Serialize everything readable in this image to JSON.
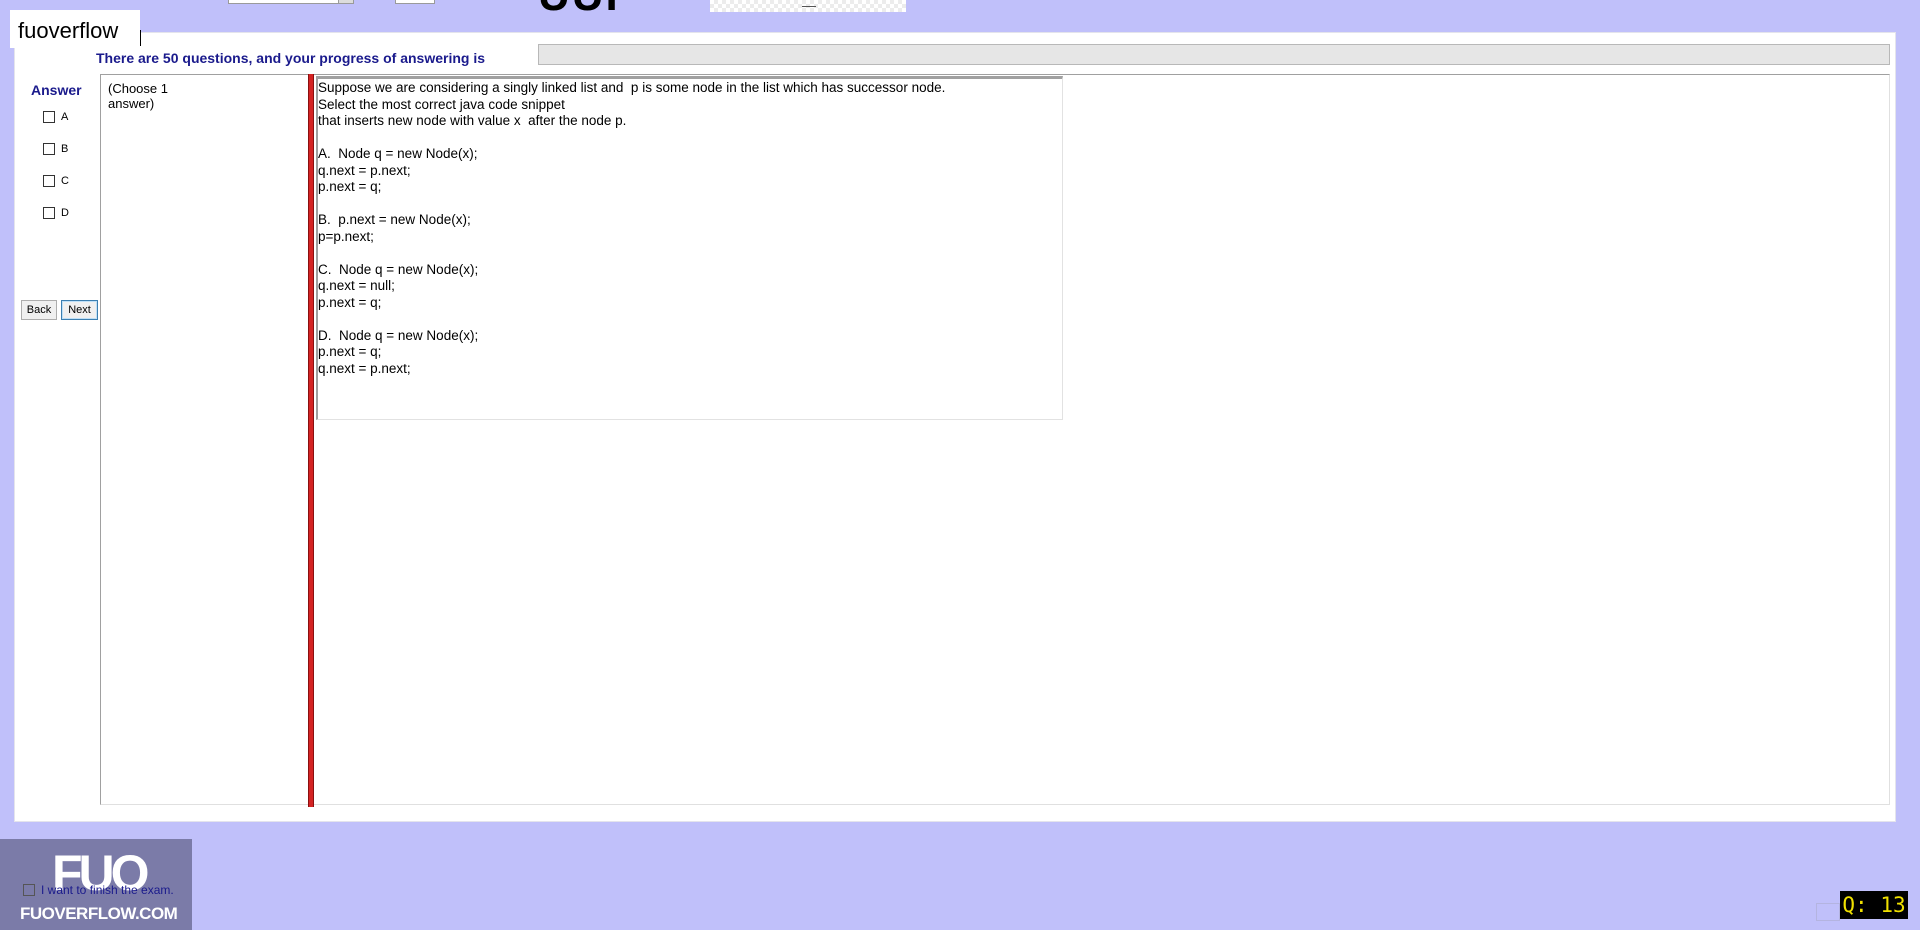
{
  "app": {
    "brand": "fuoverflow",
    "title_partial": "UUF"
  },
  "progress": {
    "label": "There are 50 questions, and your progress of answering is",
    "value_percent": 0,
    "fill_color": "#06b025"
  },
  "answer_panel": {
    "title": "Answer",
    "options": [
      {
        "label": "A",
        "checked": false
      },
      {
        "label": "B",
        "checked": false
      },
      {
        "label": "C",
        "checked": false
      },
      {
        "label": "D",
        "checked": false
      }
    ],
    "back_label": "Back",
    "next_label": "Next"
  },
  "choose": {
    "text": "(Choose 1 answer)"
  },
  "question": {
    "text": "Suppose we are considering a singly linked list and  p is some node in the list which has successor node.\nSelect the most correct java code snippet\nthat inserts new node with value x  after the node p.\n\nA.  Node q = new Node(x);\nq.next = p.next;\np.next = q;\n\nB.  p.next = new Node(x);\np=p.next;\n\nC.  Node q = new Node(x);\nq.next = null;\np.next = q;\n\nD.  Node q = new Node(x);\np.next = q;\nq.next = p.next;"
  },
  "footer": {
    "finish_label": "I want to finish the exam.",
    "logo_mark": "FUO",
    "logo_text": "FUOVERFLOW.COM",
    "question_counter": "Q: 13"
  },
  "colors": {
    "background": "#c0c0fa",
    "accent_text": "#1a1a8c",
    "splitter": "#d42323",
    "counter_text": "#f0e000"
  }
}
